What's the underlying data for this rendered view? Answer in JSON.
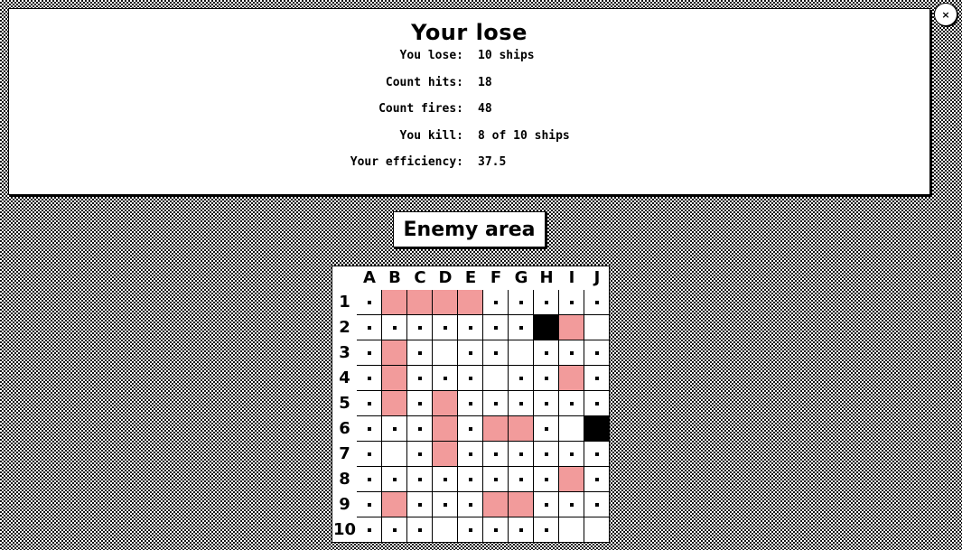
{
  "result": {
    "title": "Your lose",
    "stats": [
      {
        "label": "You lose:",
        "value": "10 ships"
      },
      {
        "label": "Count hits:",
        "value": "18"
      },
      {
        "label": "Count fires:",
        "value": "48"
      },
      {
        "label": "You kill:",
        "value": "8 of 10 ships"
      },
      {
        "label": "Your efficiency:",
        "value": "37.5"
      }
    ],
    "close_label": "×"
  },
  "area_label": "Enemy area",
  "board": {
    "columns": [
      "A",
      "B",
      "C",
      "D",
      "E",
      "F",
      "G",
      "H",
      "I",
      "J"
    ],
    "rows": [
      "1",
      "2",
      "3",
      "4",
      "5",
      "6",
      "7",
      "8",
      "9",
      "10"
    ],
    "legend_codes": {
      "d": "miss",
      "h": "hit",
      "s": "sunk",
      "e": "empty"
    },
    "cells": [
      "dhhhhdddd d",
      "ddddddsh e",
      "dhdeddddd",
      "dhddeddhd",
      "dhdhdddd",
      "dddhdhhdes",
      "deehddddd",
      "ddddddddhd",
      "dhdddhhddd",
      "dddeddde e"
    ],
    "grid": [
      [
        "d",
        "h",
        "h",
        "h",
        "h",
        "d",
        "d",
        "d",
        "d",
        "d"
      ],
      [
        "d",
        "d",
        "d",
        "d",
        "d",
        "d",
        "d",
        "s",
        "h",
        "e"
      ],
      [
        "d",
        "h",
        "d",
        "e",
        "d",
        "d",
        "e",
        "d",
        "d",
        "d"
      ],
      [
        "d",
        "h",
        "d",
        "d",
        "d",
        "e",
        "d",
        "d",
        "h",
        "d"
      ],
      [
        "d",
        "h",
        "d",
        "h",
        "d",
        "d",
        "d",
        "d",
        "d",
        "d"
      ],
      [
        "d",
        "d",
        "d",
        "h",
        "d",
        "h",
        "h",
        "d",
        "e",
        "s"
      ],
      [
        "d",
        "e",
        "d",
        "h",
        "d",
        "d",
        "d",
        "d",
        "d",
        "d"
      ],
      [
        "d",
        "d",
        "d",
        "d",
        "d",
        "d",
        "d",
        "d",
        "h",
        "d"
      ],
      [
        "d",
        "h",
        "d",
        "d",
        "d",
        "h",
        "h",
        "d",
        "d",
        "d"
      ],
      [
        "d",
        "d",
        "d",
        "e",
        "d",
        "d",
        "d",
        "d",
        "e",
        "e"
      ]
    ]
  }
}
